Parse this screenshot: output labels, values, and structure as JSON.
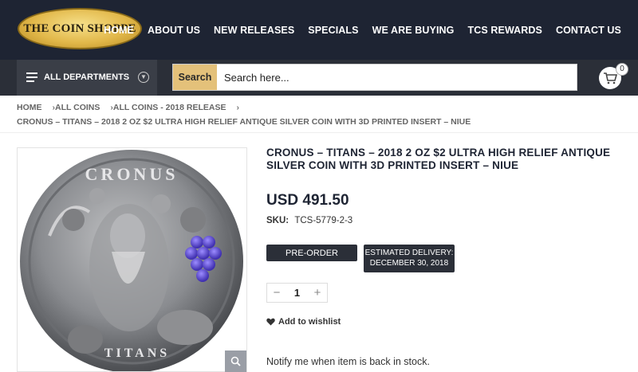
{
  "header": {
    "logo_text": "THE COIN SHOPPE",
    "nav": [
      "HOME",
      "ABOUT US",
      "NEW RELEASES",
      "SPECIALS",
      "WE ARE BUYING",
      "TCS REWARDS",
      "CONTACT US"
    ]
  },
  "subbar": {
    "departments_label": "ALL DEPARTMENTS",
    "search_button": "Search",
    "search_placeholder": "Search here...",
    "cart_count": "0"
  },
  "breadcrumb": {
    "items": [
      "HOME",
      "ALL COINS",
      "ALL COINS - 2018 RELEASE"
    ],
    "current": "CRONUS – TITANS – 2018 2 OZ $2 ULTRA HIGH RELIEF ANTIQUE SILVER COIN WITH 3D PRINTED INSERT – NIUE"
  },
  "product": {
    "title": "CRONUS – TITANS – 2018 2 OZ $2 ULTRA HIGH RELIEF ANTIQUE SILVER COIN WITH 3D PRINTED INSERT – NIUE",
    "price": "USD 491.50",
    "sku_label": "SKU:",
    "sku_value": "TCS-5779-2-3",
    "preorder_label": "PRE-ORDER",
    "delivery_line1": "ESTIMATED DELIVERY:",
    "delivery_line2": "DECEMBER 30, 2018",
    "quantity": "1",
    "wishlist_label": "Add to wishlist",
    "notify_text": "Notify me when item is back in stock.",
    "coin_inscription_top": "CRONUS",
    "coin_inscription_bottom": "TITANS"
  },
  "colors": {
    "header_bg": "#1e2433",
    "subbar_bg": "#2b2f38",
    "search_accent": "#e4c17a",
    "grape_purple": "#6b5bd6"
  }
}
